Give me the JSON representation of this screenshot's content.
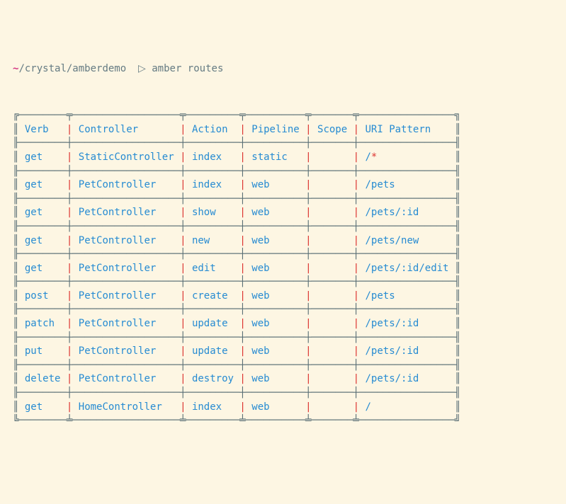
{
  "prompt": {
    "tilde": "~",
    "path": "/crystal/amberdemo",
    "caret": "▷",
    "command": "amber routes"
  },
  "headers": [
    "Verb",
    "Controller",
    "Action",
    "Pipeline",
    "Scope",
    "URI Pattern"
  ],
  "rows": [
    {
      "verb": "get",
      "controller": "StaticController",
      "action": "index",
      "pipeline": "static",
      "scope": "",
      "uri": "/",
      "uri_suffix": "*"
    },
    {
      "verb": "get",
      "controller": "PetController",
      "action": "index",
      "pipeline": "web",
      "scope": "",
      "uri": "/pets"
    },
    {
      "verb": "get",
      "controller": "PetController",
      "action": "show",
      "pipeline": "web",
      "scope": "",
      "uri": "/pets/:id"
    },
    {
      "verb": "get",
      "controller": "PetController",
      "action": "new",
      "pipeline": "web",
      "scope": "",
      "uri": "/pets/new"
    },
    {
      "verb": "get",
      "controller": "PetController",
      "action": "edit",
      "pipeline": "web",
      "scope": "",
      "uri": "/pets/:id/edit"
    },
    {
      "verb": "post",
      "controller": "PetController",
      "action": "create",
      "pipeline": "web",
      "scope": "",
      "uri": "/pets"
    },
    {
      "verb": "patch",
      "controller": "PetController",
      "action": "update",
      "pipeline": "web",
      "scope": "",
      "uri": "/pets/:id"
    },
    {
      "verb": "put",
      "controller": "PetController",
      "action": "update",
      "pipeline": "web",
      "scope": "",
      "uri": "/pets/:id"
    },
    {
      "verb": "delete",
      "controller": "PetController",
      "action": "destroy",
      "pipeline": "web",
      "scope": "",
      "uri": "/pets/:id"
    },
    {
      "verb": "get",
      "controller": "HomeController",
      "action": "index",
      "pipeline": "web",
      "scope": "",
      "uri": "/"
    }
  ],
  "widths": {
    "verb": 8,
    "controller": 18,
    "action": 9,
    "pipeline": 10,
    "scope": 7,
    "uri": 16
  },
  "chart_data": {
    "type": "table",
    "title": "amber routes",
    "columns": [
      "Verb",
      "Controller",
      "Action",
      "Pipeline",
      "Scope",
      "URI Pattern"
    ],
    "rows": [
      [
        "get",
        "StaticController",
        "index",
        "static",
        "",
        "/*"
      ],
      [
        "get",
        "PetController",
        "index",
        "web",
        "",
        "/pets"
      ],
      [
        "get",
        "PetController",
        "show",
        "web",
        "",
        "/pets/:id"
      ],
      [
        "get",
        "PetController",
        "new",
        "web",
        "",
        "/pets/new"
      ],
      [
        "get",
        "PetController",
        "edit",
        "web",
        "",
        "/pets/:id/edit"
      ],
      [
        "post",
        "PetController",
        "create",
        "web",
        "",
        "/pets"
      ],
      [
        "patch",
        "PetController",
        "update",
        "web",
        "",
        "/pets/:id"
      ],
      [
        "put",
        "PetController",
        "update",
        "web",
        "",
        "/pets/:id"
      ],
      [
        "delete",
        "PetController",
        "destroy",
        "web",
        "",
        "/pets/:id"
      ],
      [
        "get",
        "HomeController",
        "index",
        "web",
        "",
        "/"
      ]
    ]
  }
}
